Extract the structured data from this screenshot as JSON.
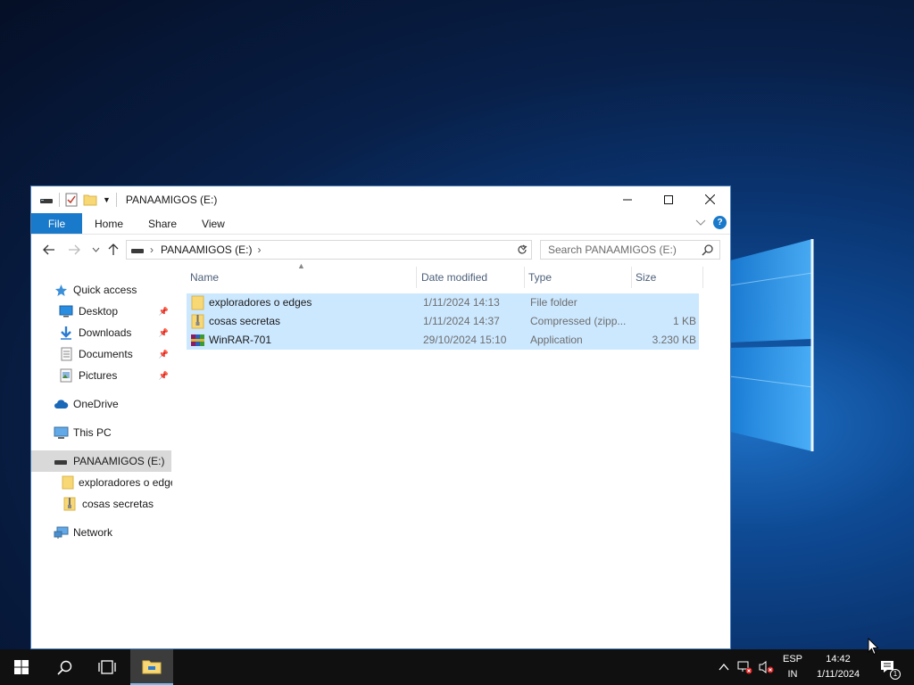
{
  "window": {
    "title": "PANAAMIGOS (E:)",
    "controls": {
      "minimize": "minimize",
      "maximize": "maximize",
      "close": "close"
    }
  },
  "ribbon": {
    "tabs": [
      "File",
      "Home",
      "Share",
      "View"
    ],
    "accent": "#1979ca",
    "help": "?"
  },
  "navigation": {
    "breadcrumb": [
      "PANAAMIGOS (E:)"
    ],
    "search_placeholder": "Search PANAAMIGOS (E:)"
  },
  "navpane": {
    "quick_access": "Quick access",
    "quick_items": [
      {
        "label": "Desktop",
        "icon": "desktop-icon"
      },
      {
        "label": "Downloads",
        "icon": "download-icon"
      },
      {
        "label": "Documents",
        "icon": "documents-icon"
      },
      {
        "label": "Pictures",
        "icon": "pictures-icon"
      }
    ],
    "onedrive": "OneDrive",
    "this_pc": "This PC",
    "drive": "PANAAMIGOS (E:)",
    "drive_children": [
      "exploradores o edges",
      "cosas secretas"
    ],
    "network": "Network"
  },
  "filelist": {
    "columns": [
      "Name",
      "Date modified",
      "Type",
      "Size"
    ],
    "selection_color": "#cce8ff",
    "rows": [
      {
        "name": "exploradores o edges",
        "date": "1/11/2024 14:13",
        "type": "File folder",
        "size": "",
        "icon": "folder-icon"
      },
      {
        "name": "cosas secretas",
        "date": "1/11/2024 14:37",
        "type": "Compressed (zipp...",
        "size": "1 KB",
        "icon": "zip-folder-icon"
      },
      {
        "name": "WinRAR-701",
        "date": "29/10/2024 15:10",
        "type": "Application",
        "size": "3.230 KB",
        "icon": "winrar-icon"
      }
    ]
  },
  "taskbar": {
    "language": "ESP",
    "layout": "IN",
    "time": "14:42",
    "date": "1/11/2024",
    "notifications_count": "1"
  }
}
